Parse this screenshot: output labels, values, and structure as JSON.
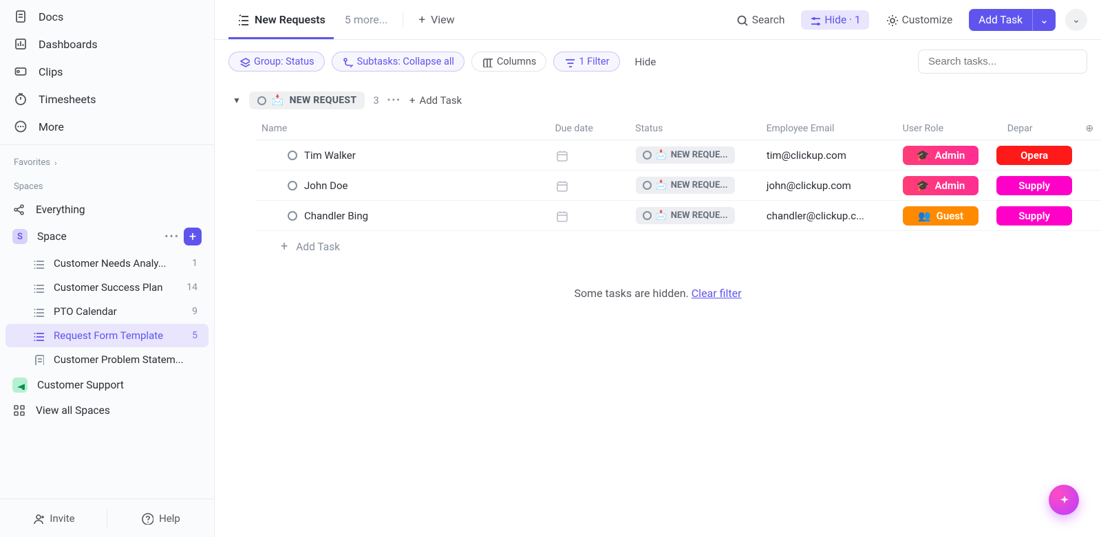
{
  "sidebar": {
    "nav": [
      {
        "label": "Docs",
        "icon": "doc"
      },
      {
        "label": "Dashboards",
        "icon": "dash"
      },
      {
        "label": "Clips",
        "icon": "clip"
      },
      {
        "label": "Timesheets",
        "icon": "timer"
      },
      {
        "label": "More",
        "icon": "more"
      }
    ],
    "favorites_label": "Favorites",
    "spaces_label": "Spaces",
    "everything_label": "Everything",
    "space_name": "Space",
    "space_initial": "S",
    "lists": [
      {
        "name": "Customer Needs Analy...",
        "count": "1",
        "active": false,
        "icon": "list"
      },
      {
        "name": "Customer Success Plan",
        "count": "14",
        "active": false,
        "icon": "list"
      },
      {
        "name": "PTO Calendar",
        "count": "9",
        "active": false,
        "icon": "list"
      },
      {
        "name": "Request Form Template",
        "count": "5",
        "active": true,
        "icon": "list"
      },
      {
        "name": "Customer Problem Statem...",
        "count": "",
        "active": false,
        "icon": "doc"
      }
    ],
    "customer_support": "Customer Support",
    "view_all": "View all Spaces",
    "invite": "Invite",
    "help": "Help"
  },
  "header": {
    "active_tab": "New Requests",
    "more_tabs": "5 more...",
    "view": "View",
    "search": "Search",
    "hide": "Hide · 1",
    "customize": "Customize",
    "add_task": "Add Task"
  },
  "filters": {
    "group": "Group: Status",
    "subtasks": "Subtasks: Collapse all",
    "columns": "Columns",
    "filter": "1 Filter",
    "hide": "Hide",
    "search_placeholder": "Search tasks..."
  },
  "group": {
    "status_label": "NEW REQUEST",
    "status_emoji": "📩",
    "count": "3",
    "add_task": "Add Task"
  },
  "columns": {
    "name": "Name",
    "due": "Due date",
    "status": "Status",
    "email": "Employee Email",
    "role": "User Role",
    "dept": "Depar"
  },
  "tasks": [
    {
      "name": "Tim Walker",
      "status": "NEW REQUE...",
      "email": "tim@clickup.com",
      "role": "Admin",
      "role_emoji": "🎓",
      "role_class": "admin",
      "dept": "Opera",
      "dept_class": "oper"
    },
    {
      "name": "John Doe",
      "status": "NEW REQUE...",
      "email": "john@clickup.com",
      "role": "Admin",
      "role_emoji": "🎓",
      "role_class": "admin",
      "dept": "Supply",
      "dept_class": "supply"
    },
    {
      "name": "Chandler Bing",
      "status": "NEW REQUE...",
      "email": "chandler@clickup.c...",
      "role": "Guest",
      "role_emoji": "👥",
      "role_class": "guest",
      "dept": "Supply",
      "dept_class": "supply"
    }
  ],
  "new_task_row": "Add Task",
  "hidden": {
    "msg": "Some tasks are hidden. ",
    "link": "Clear filter"
  }
}
